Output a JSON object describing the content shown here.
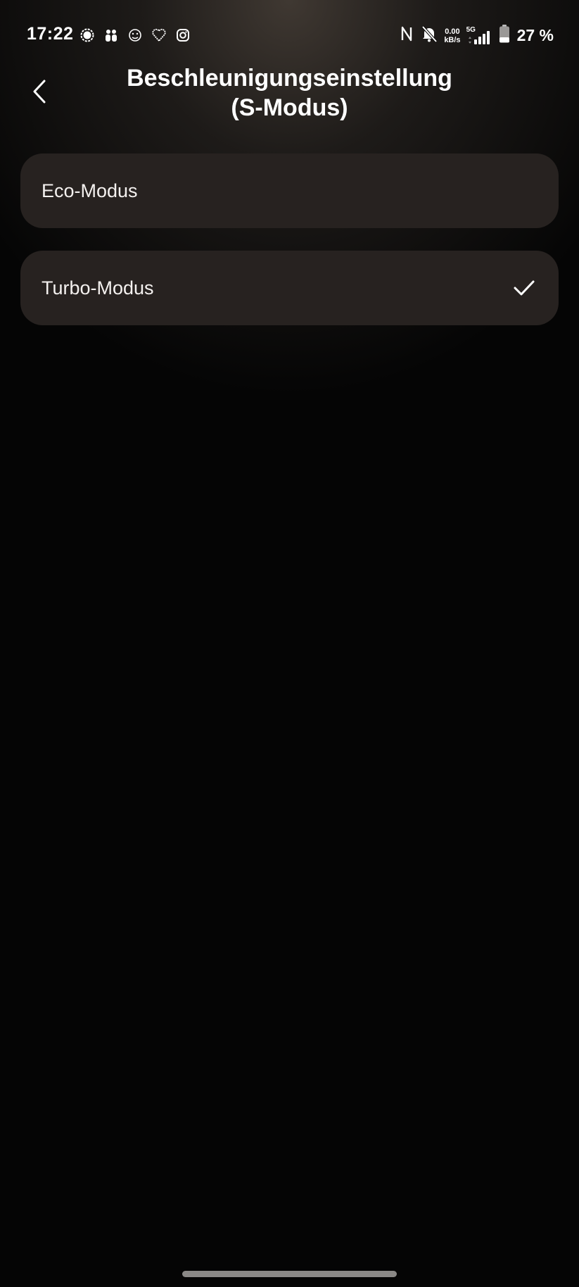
{
  "status_bar": {
    "time": "17:22",
    "left_icons": [
      "signal-messenger-icon",
      "contacts-icon",
      "lion-app-icon",
      "heart-rate-icon",
      "instagram-icon"
    ],
    "nfc_icon": "nfc-icon",
    "mute_icon": "bell-off-icon",
    "net_speed_value": "0.00",
    "net_speed_unit": "kB/s",
    "network_type": "5G",
    "battery_percent": "27 %"
  },
  "header": {
    "back_icon": "chevron-left-icon",
    "title": "Beschleunigungseinstellung\n(S-Modus)"
  },
  "options": [
    {
      "label": "Eco-Modus",
      "selected": false
    },
    {
      "label": "Turbo-Modus",
      "selected": true
    }
  ],
  "colors": {
    "background": "#050505",
    "card": "#272220",
    "text": "#ffffff"
  }
}
